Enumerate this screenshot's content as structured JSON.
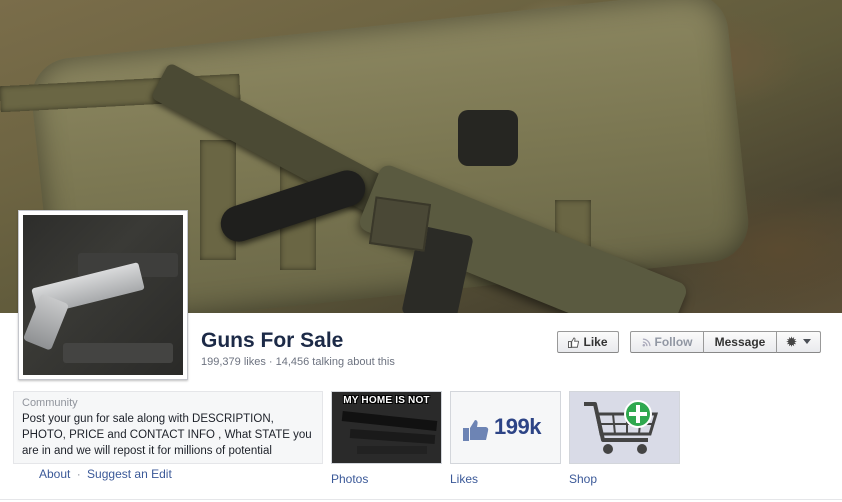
{
  "page": {
    "name": "Guns For Sale",
    "stats": "199,379 likes · 14,456 talking about this"
  },
  "actions": {
    "like": "Like",
    "follow": "Follow",
    "message": "Message"
  },
  "about": {
    "category": "Community",
    "description": "Post your gun for sale along with DESCRIPTION, PHOTO, PRICE and CONTACT INFO , What STATE you are in and we will repost it for millions of potential",
    "link_about": "About",
    "separator": "·",
    "link_suggest": "Suggest an Edit"
  },
  "tiles": {
    "photos_label": "Photos",
    "photos_caption": "MY HOME IS NOT",
    "likes_label": "Likes",
    "likes_count": "199k",
    "shop_label": "Shop"
  },
  "icons": [
    "thumbs-up-icon",
    "rss-icon",
    "gear-icon",
    "caret-down-icon",
    "shopping-cart-icon",
    "plus-icon"
  ],
  "colors": {
    "link": "#3b5998",
    "title": "#1c2a47",
    "shop_plus": "#2fa84f"
  }
}
